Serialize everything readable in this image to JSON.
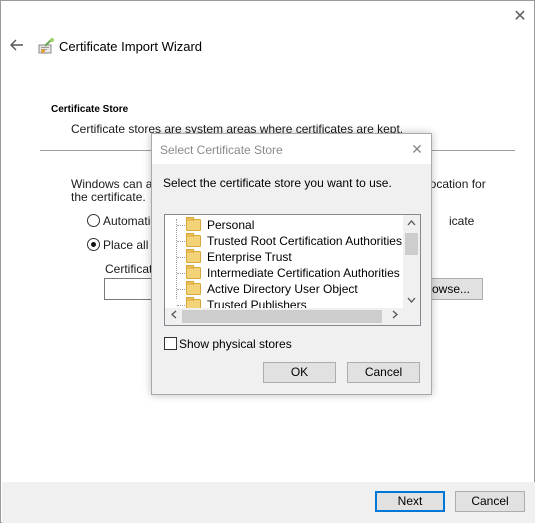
{
  "wizard": {
    "title": "Certificate Import Wizard",
    "close_glyph": "✕",
    "section_title": "Certificate Store",
    "section_desc": "Certificate stores are system areas where certificates are kept.",
    "bg_text_line1_start": "Windows can au",
    "bg_text_line1_end": "location for",
    "bg_text_line2": "the certificate.",
    "radio_auto_label": "Automatic",
    "radio_auto_label_end": "icate",
    "radio_place_label": "Place all ce",
    "cert_store_label": "Certificate",
    "browse_label": "rowse...",
    "next_label": "Next",
    "cancel_label": "Cancel"
  },
  "dialog": {
    "title": "Select Certificate Store",
    "close_glyph": "✕",
    "prompt": "Select the certificate store you want to use.",
    "stores": [
      "Personal",
      "Trusted Root Certification Authorities",
      "Enterprise Trust",
      "Intermediate Certification Authorities",
      "Active Directory User Object",
      "Trusted Publishers"
    ],
    "show_physical_label": "Show physical stores",
    "show_physical_checked": false,
    "ok_label": "OK",
    "cancel_label": "Cancel"
  },
  "colors": {
    "default_button_border": "#0078d7",
    "footer_bg": "#f0f0f0",
    "folder": "#f3d378"
  },
  "icons": {
    "back": "back-arrow-icon",
    "wizard": "certificate-wizard-icon",
    "folder": "folder-icon"
  }
}
